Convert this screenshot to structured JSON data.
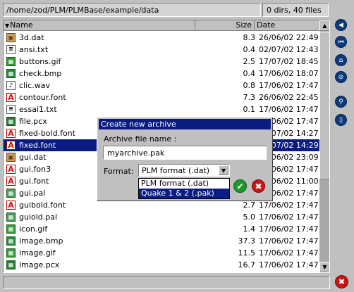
{
  "path": "/home/zod/PLM/PLMBase/example/data",
  "count": "0 dirs, 40 files",
  "columns": {
    "name": "Name",
    "size": "Size",
    "date": "Date"
  },
  "files": [
    {
      "name": "3d.dat",
      "size": "8.3",
      "date": "26/06/02 22:49",
      "icon": "dat"
    },
    {
      "name": "ansi.txt",
      "size": "0.4",
      "date": "02/07/02 12:43",
      "icon": "txt"
    },
    {
      "name": "buttons.gif",
      "size": "2.5",
      "date": "17/07/02 18:45",
      "icon": "gif"
    },
    {
      "name": "check.bmp",
      "size": "0.4",
      "date": "17/06/02 18:07",
      "icon": "bmp"
    },
    {
      "name": "clic.wav",
      "size": "0.8",
      "date": "17/06/02 17:47",
      "icon": "wav"
    },
    {
      "name": "contour.font",
      "size": "7.3",
      "date": "26/06/02 22:45",
      "icon": "font"
    },
    {
      "name": "essai1.txt",
      "size": "0.1",
      "date": "17/06/02 17:47",
      "icon": "txt"
    },
    {
      "name": "file.pcx",
      "size": "",
      "date": "17/06/02 17:47",
      "icon": "pcx"
    },
    {
      "name": "fixed-bold.font",
      "size": "",
      "date": "17/07/02 14:27",
      "icon": "font"
    },
    {
      "name": "fixed.font",
      "size": "",
      "date": "17/07/02 14:29",
      "icon": "font",
      "selected": true
    },
    {
      "name": "gui.dat",
      "size": "",
      "date": "26/06/02 23:09",
      "icon": "dat"
    },
    {
      "name": "gui.fon3",
      "size": "",
      "date": "17/06/02 17:47",
      "icon": "font"
    },
    {
      "name": "gui.font",
      "size": "",
      "date": "17/06/02 11:00",
      "icon": "font"
    },
    {
      "name": "gui.pal",
      "size": "",
      "date": "17/06/02 17:47",
      "icon": "pal"
    },
    {
      "name": "guibold.font",
      "size": "2.7",
      "date": "17/06/02 17:47",
      "icon": "font"
    },
    {
      "name": "guiold.pal",
      "size": "5.0",
      "date": "17/06/02 17:47",
      "icon": "pal"
    },
    {
      "name": "icon.gif",
      "size": "1.4",
      "date": "17/06/02 17:47",
      "icon": "gif"
    },
    {
      "name": "image.bmp",
      "size": "37.3",
      "date": "17/06/02 17:47",
      "icon": "bmp"
    },
    {
      "name": "image.gif",
      "size": "11.5",
      "date": "17/06/02 17:47",
      "icon": "gif"
    },
    {
      "name": "image.pcx",
      "size": "16.7",
      "date": "17/06/02 17:47",
      "icon": "pcx"
    }
  ],
  "side_buttons": [
    {
      "name": "back-icon",
      "glyph": "◀"
    },
    {
      "name": "first-icon",
      "glyph": "⏮"
    },
    {
      "name": "home-icon",
      "glyph": "⌂"
    },
    {
      "name": "no-access-icon",
      "glyph": "⊘"
    },
    {
      "name": "search-icon",
      "glyph": "⚲"
    },
    {
      "name": "document-icon",
      "glyph": "▯"
    }
  ],
  "dialog": {
    "title": "Create new archive",
    "archive_label": "Archive file name :",
    "archive_value": "myarchive.pak",
    "format_label": "Format:",
    "format_selected": "PLM format (.dat)",
    "format_options": [
      "PLM format (.dat)",
      "Quake 1 & 2 (.pak)"
    ],
    "highlighted_option": 1,
    "ok_glyph": "✔",
    "cancel_glyph": "✖"
  },
  "exit_glyph": "✖"
}
